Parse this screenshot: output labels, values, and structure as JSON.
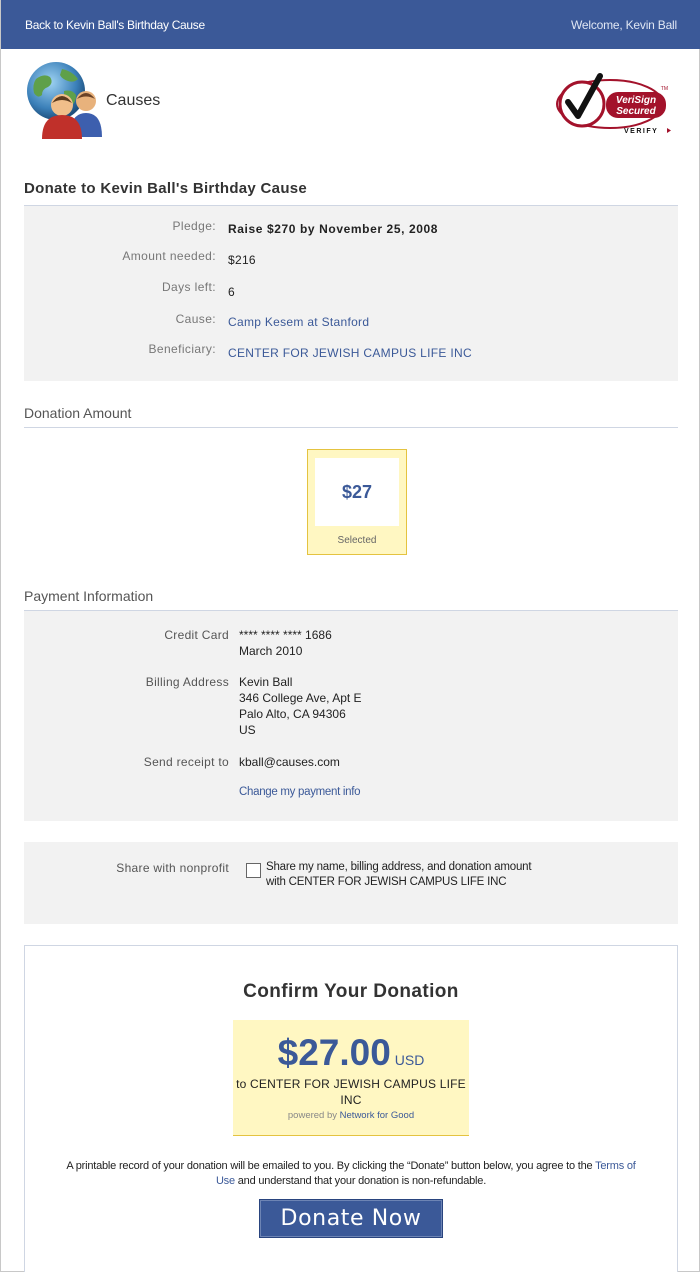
{
  "topbar": {
    "back_label": "Back to Kevin Ball's Birthday Cause",
    "welcome_text": "Welcome, Kevin Ball"
  },
  "header": {
    "brand": "Causes",
    "logo_icon": "globe-people-icon",
    "badge": {
      "line1": "VeriSign",
      "line2": "Secured",
      "line3": "VERIFY",
      "tm": "TM"
    }
  },
  "page_title": "Donate to Kevin Ball's Birthday Cause",
  "cause_details": [
    {
      "key": "Pledge:",
      "value": "Raise $270 by November 25, 2008",
      "style": "bold"
    },
    {
      "key": "Amount needed:",
      "value": "$216",
      "style": "plain"
    },
    {
      "key": "Days left:",
      "value": "6",
      "style": "plain"
    },
    {
      "key": "Cause:",
      "value": "Camp Kesem at Stanford",
      "style": "link"
    },
    {
      "key": "Beneficiary:",
      "value": "CENTER FOR JEWISH CAMPUS LIFE INC",
      "style": "link"
    }
  ],
  "donation_amount": {
    "title": "Donation Amount",
    "amount": "$27",
    "note": "Selected"
  },
  "payment": {
    "title": "Payment Information",
    "credit_card_label": "Credit Card",
    "card_number": "**** **** **** 1686",
    "card_expiry": "March 2010",
    "billing_label": "Billing Address",
    "billing_lines": [
      "Kevin Ball",
      "346 College Ave, Apt E",
      "Palo Alto, CA 94306",
      "US"
    ],
    "receipt_label": "Send receipt to",
    "receipt_email": "kball@causes.com",
    "change_link": "Change my payment info"
  },
  "share": {
    "label": "Share with nonprofit",
    "checked": false,
    "text": "Share my name, billing address, and donation amount with CENTER FOR JEWISH CAMPUS LIFE INC"
  },
  "confirm": {
    "title": "Confirm Your Donation",
    "amount": "$27.00",
    "currency": "USD",
    "to_text": "to CENTER FOR JEWISH CAMPUS LIFE INC",
    "powered_prefix": "powered by",
    "powered_link": "Network for Good",
    "legal_before": "A printable record of your donation will be emailed to you. By clicking the “Donate” button below, you agree to the",
    "legal_link": "Terms of Use",
    "legal_after": "and understand that your donation is non-refundable.",
    "button_label": "Donate Now"
  },
  "colors": {
    "brand_blue": "#3b5998",
    "panel_gray": "#f2f2f2",
    "highlight_yellow": "#fff7c2",
    "highlight_border": "#e4c340",
    "verisign_red": "#a3122b"
  }
}
